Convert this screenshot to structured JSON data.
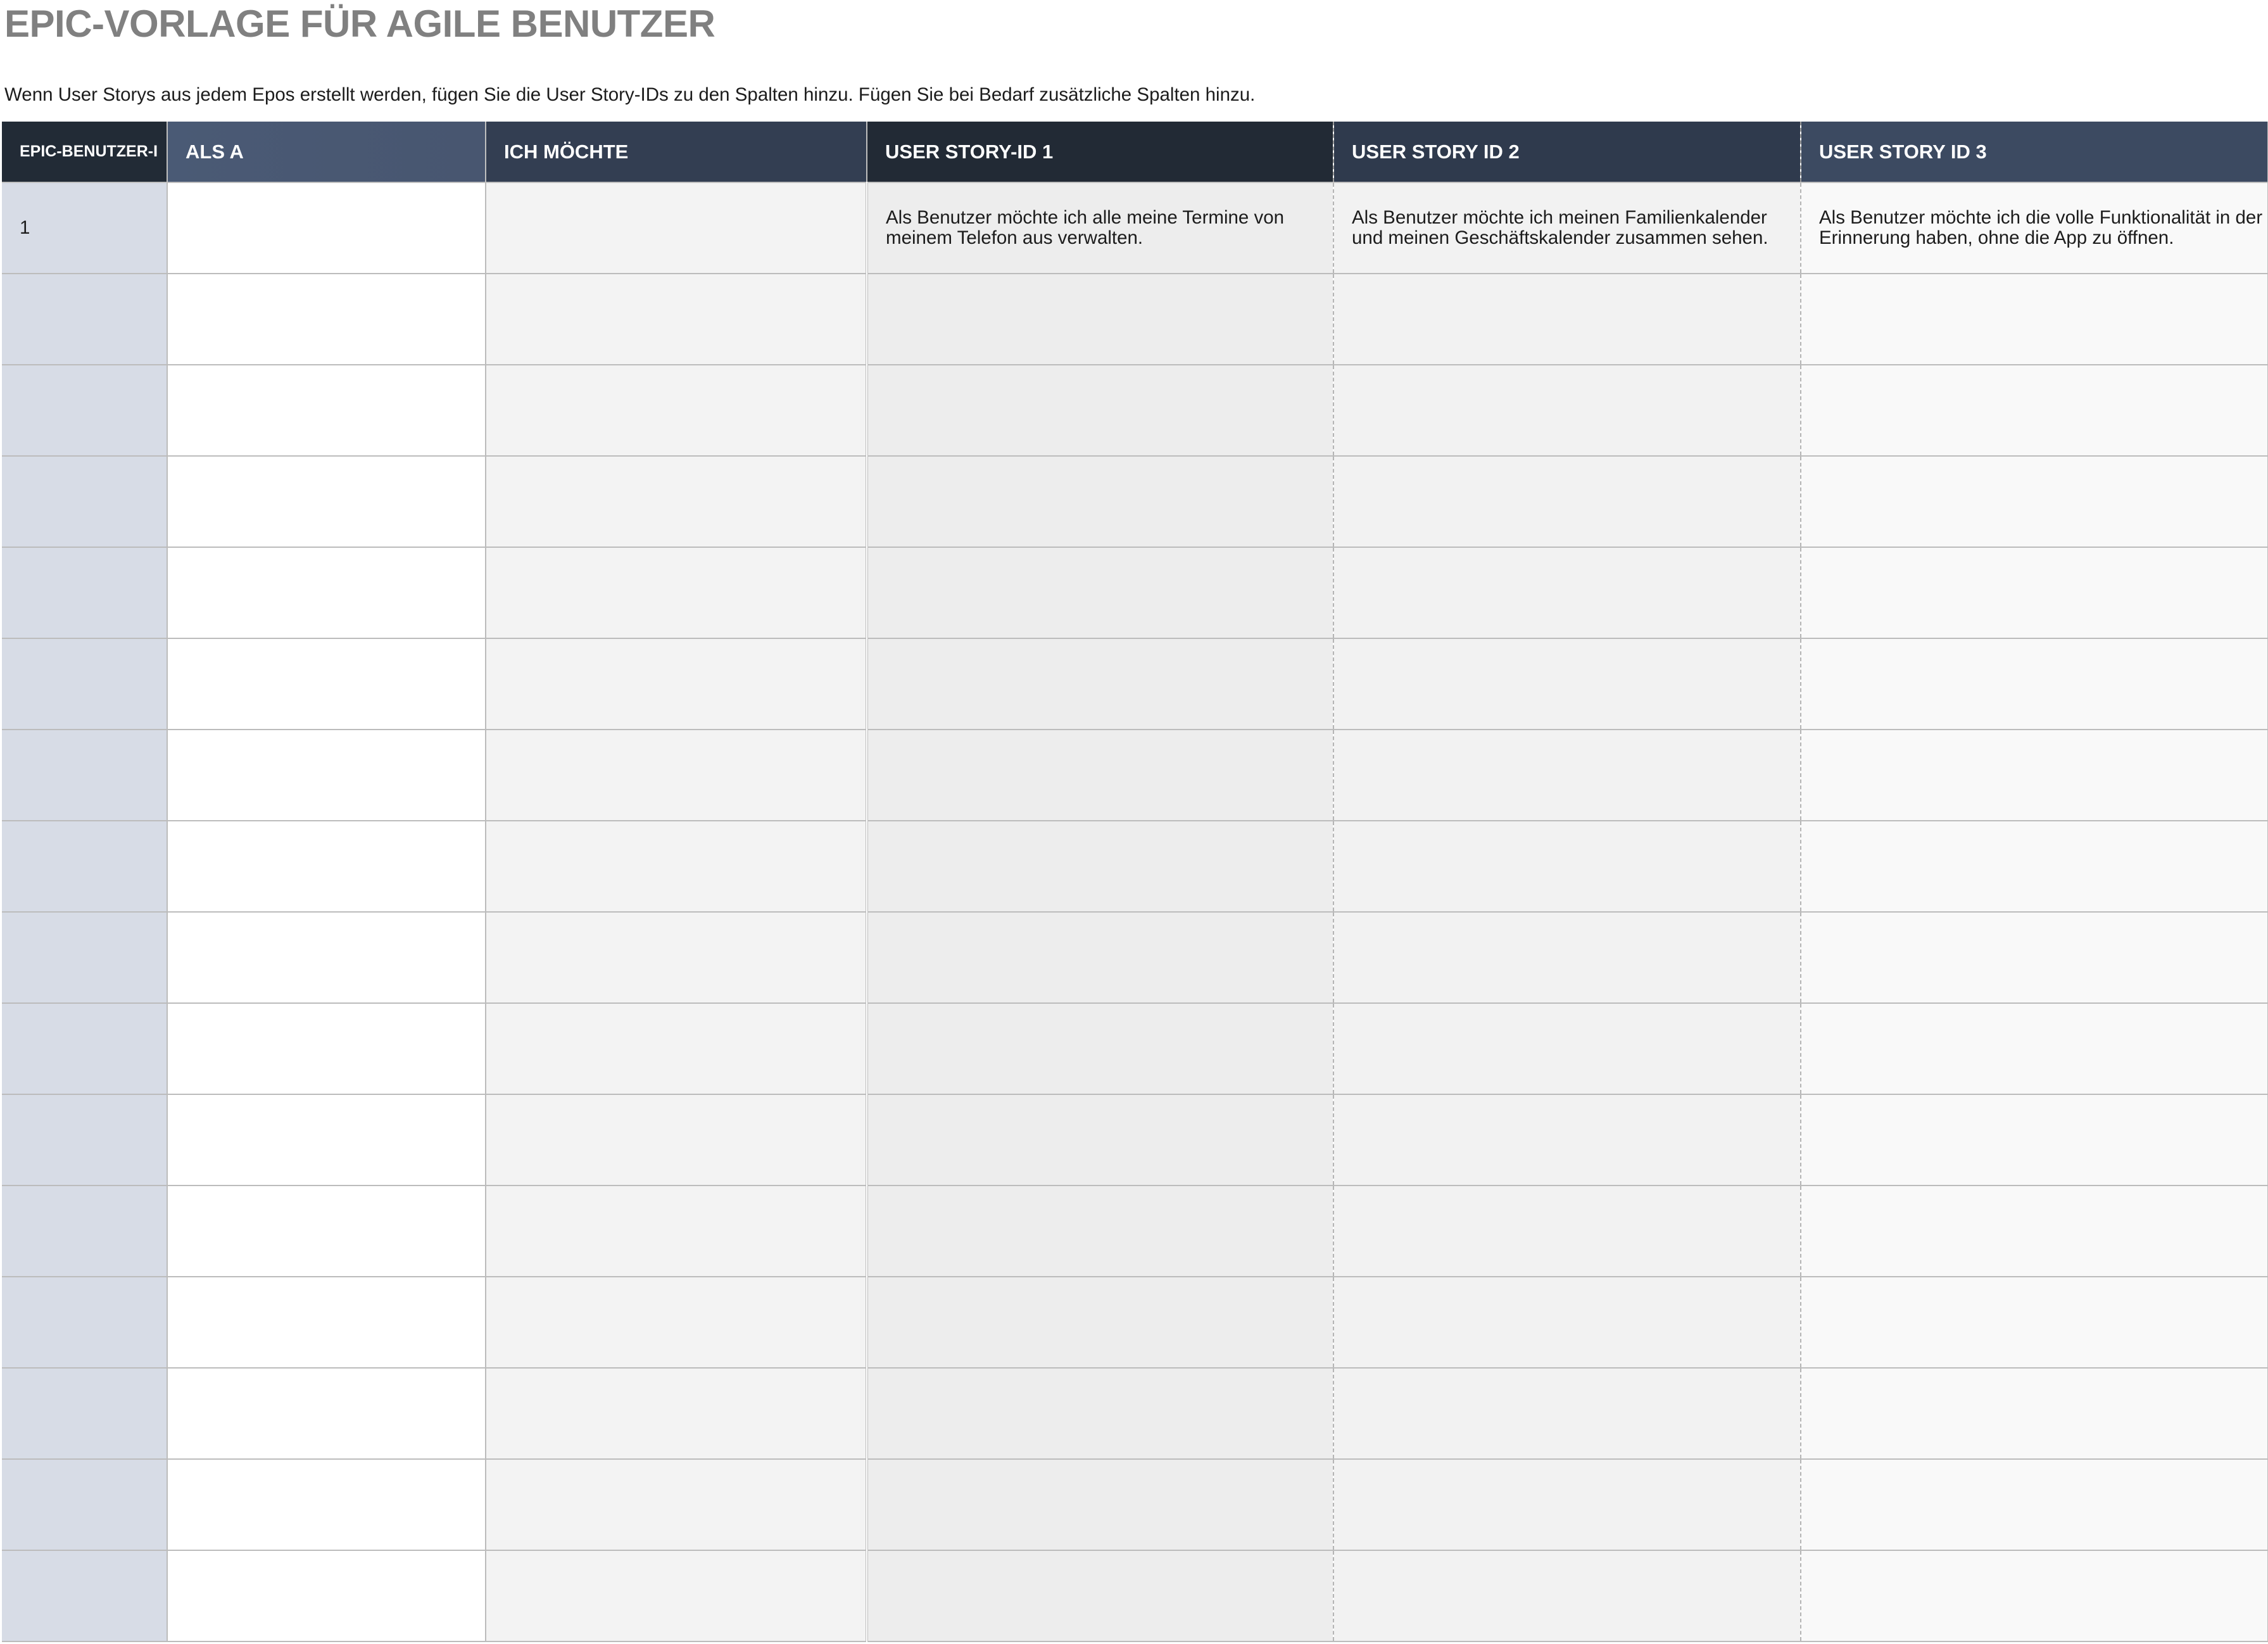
{
  "title": "EPIC-VORLAGE FÜR AGILE BENUTZER",
  "subtitle": "Wenn User Storys aus jedem Epos erstellt werden, fügen Sie die User Story-IDs zu den Spalten hinzu. Fügen Sie bei Bedarf zusätzliche Spalten hinzu.",
  "table": {
    "headers": [
      "EPIC-BENUTZER-I",
      "ALS A",
      "ICH MÖCHTE",
      "USER STORY-ID 1",
      "USER STORY ID 2",
      "USER STORY ID 3"
    ],
    "rows": [
      {
        "id": "1",
        "als_a": "",
        "ich_moechte": "",
        "story1": [
          "Als Benutzer möchte ich alle meine Termine von",
          "meinem Telefon aus verwalten."
        ],
        "story2": [
          "Als Benutzer möchte ich meinen Familienkalender",
          "und meinen Geschäftskalender zusammen sehen."
        ],
        "story3": [
          "Als Benutzer möchte ich die volle Funktionalität in der",
          "Erinnerung haben, ohne die App zu öffnen."
        ]
      }
    ],
    "empty_row_count": 15
  }
}
